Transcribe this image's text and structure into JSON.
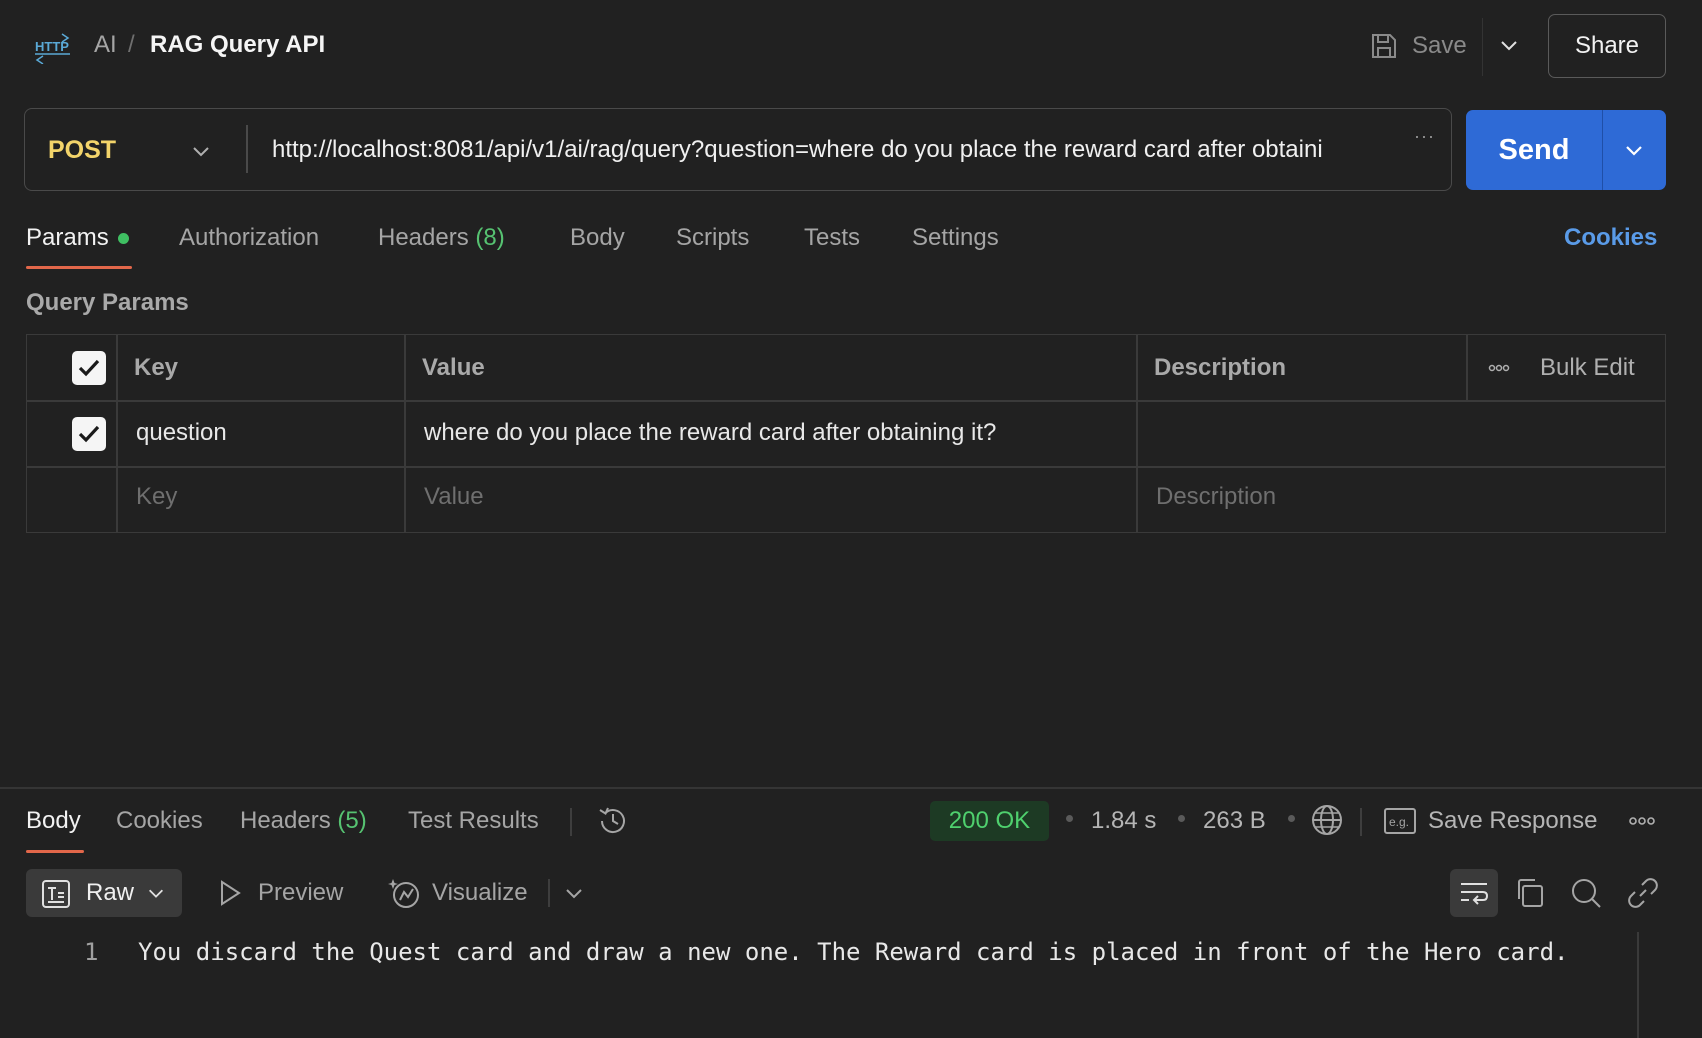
{
  "header": {
    "breadcrumb_parent": "AI",
    "breadcrumb_sep": "/",
    "title": "RAG Query API",
    "save_label": "Save",
    "share_label": "Share"
  },
  "request": {
    "method": "POST",
    "url": "http://localhost:8081/api/v1/ai/rag/query?question=where do you place the reward card after obtaini",
    "send_label": "Send"
  },
  "request_tabs": {
    "params": "Params",
    "authorization": "Authorization",
    "headers": "Headers",
    "headers_count": "(8)",
    "body": "Body",
    "scripts": "Scripts",
    "tests": "Tests",
    "settings": "Settings",
    "cookies": "Cookies"
  },
  "query_params": {
    "section_title": "Query Params",
    "columns": {
      "key": "Key",
      "value": "Value",
      "description": "Description"
    },
    "bulk_edit": "Bulk Edit",
    "rows": [
      {
        "checked": true,
        "key": "question",
        "value": "where do you place the reward card after obtaining it?",
        "description": ""
      }
    ],
    "placeholders": {
      "key": "Key",
      "value": "Value",
      "description": "Description"
    }
  },
  "response": {
    "tabs": {
      "body": "Body",
      "cookies": "Cookies",
      "headers": "Headers",
      "headers_count": "(5)",
      "test_results": "Test Results"
    },
    "status": "200 OK",
    "time": "1.84 s",
    "size": "263 B",
    "save_response": "Save Response",
    "view_mode": "Raw",
    "preview": "Preview",
    "visualize": "Visualize",
    "lines": [
      {
        "number": "1",
        "text": "You discard the Quest card and draw a new one. The Reward card is placed in front of the Hero card."
      }
    ]
  },
  "colors": {
    "accent": "#2e6ad6",
    "method": "#f3d46a",
    "status_ok": "#4fd06e",
    "tab_underline": "#e2674a",
    "link": "#5a9be8"
  }
}
